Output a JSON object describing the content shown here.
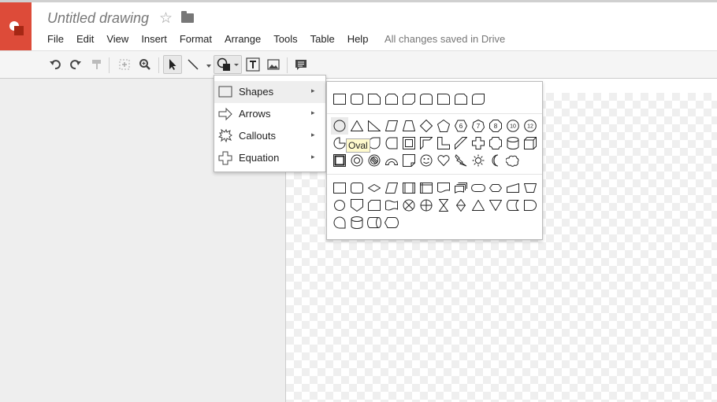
{
  "app": {
    "title": "Untitled drawing",
    "save_status": "All changes saved in Drive",
    "brand_color": "#dd4b39"
  },
  "menubar": {
    "items": [
      {
        "label": "File"
      },
      {
        "label": "Edit"
      },
      {
        "label": "View"
      },
      {
        "label": "Insert"
      },
      {
        "label": "Format"
      },
      {
        "label": "Arrange"
      },
      {
        "label": "Tools"
      },
      {
        "label": "Table"
      },
      {
        "label": "Help"
      }
    ]
  },
  "toolbar": {
    "buttons": [
      "undo-icon",
      "redo-icon",
      "paint-format-icon",
      "select-zoom-icon",
      "zoom-icon",
      "select-icon",
      "line-icon",
      "shape-icon",
      "text-box-icon",
      "image-icon",
      "comment-icon"
    ]
  },
  "insert_menu": {
    "items": [
      {
        "label": "Shapes",
        "icon": "rectangle-icon",
        "arrow": "▸"
      },
      {
        "label": "Arrows",
        "icon": "arrow-icon",
        "arrow": "▸"
      },
      {
        "label": "Callouts",
        "icon": "callout-icon",
        "arrow": "▸"
      },
      {
        "label": "Equation",
        "icon": "plus-icon",
        "arrow": "▸"
      }
    ]
  },
  "shapes_menu": {
    "numbered_shapes": [
      "6",
      "7",
      "8",
      "10",
      "12"
    ],
    "tooltip": "Oval"
  }
}
